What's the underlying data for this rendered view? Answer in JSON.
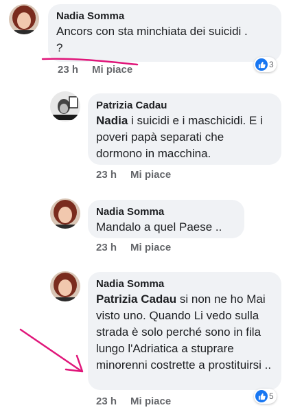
{
  "comments": [
    {
      "author": "Nadia Somma",
      "text": "Ancors con sta minchiata dei suicidi . ?",
      "time": "23 h",
      "like": "Mi piace",
      "reactions": "3"
    },
    {
      "author": "Patrizia Cadau",
      "mention": "Nadia",
      "text": " i suicidi e i maschicidi. E i poveri papà separati che dormono in macchina.",
      "time": "23 h",
      "like": "Mi piace"
    },
    {
      "author": "Nadia Somma",
      "text": "Mandalo a quel Paese ..",
      "time": "23 h",
      "like": "Mi piace"
    },
    {
      "author": "Nadia Somma",
      "mention": "Patrizia Cadau",
      "text": " si non ne ho Mai visto uno. Quando Li vedo sulla strada è solo perché sono in fila lungo l'Adriatica a stuprare minorenni costrette a prostituirsi  ..",
      "time": "23 h",
      "like": "Mi piace",
      "reactions": "5"
    }
  ],
  "colors": {
    "bubble": "#f0f2f5",
    "like_blue": "#1877f2",
    "annotation": "#e0167a"
  }
}
